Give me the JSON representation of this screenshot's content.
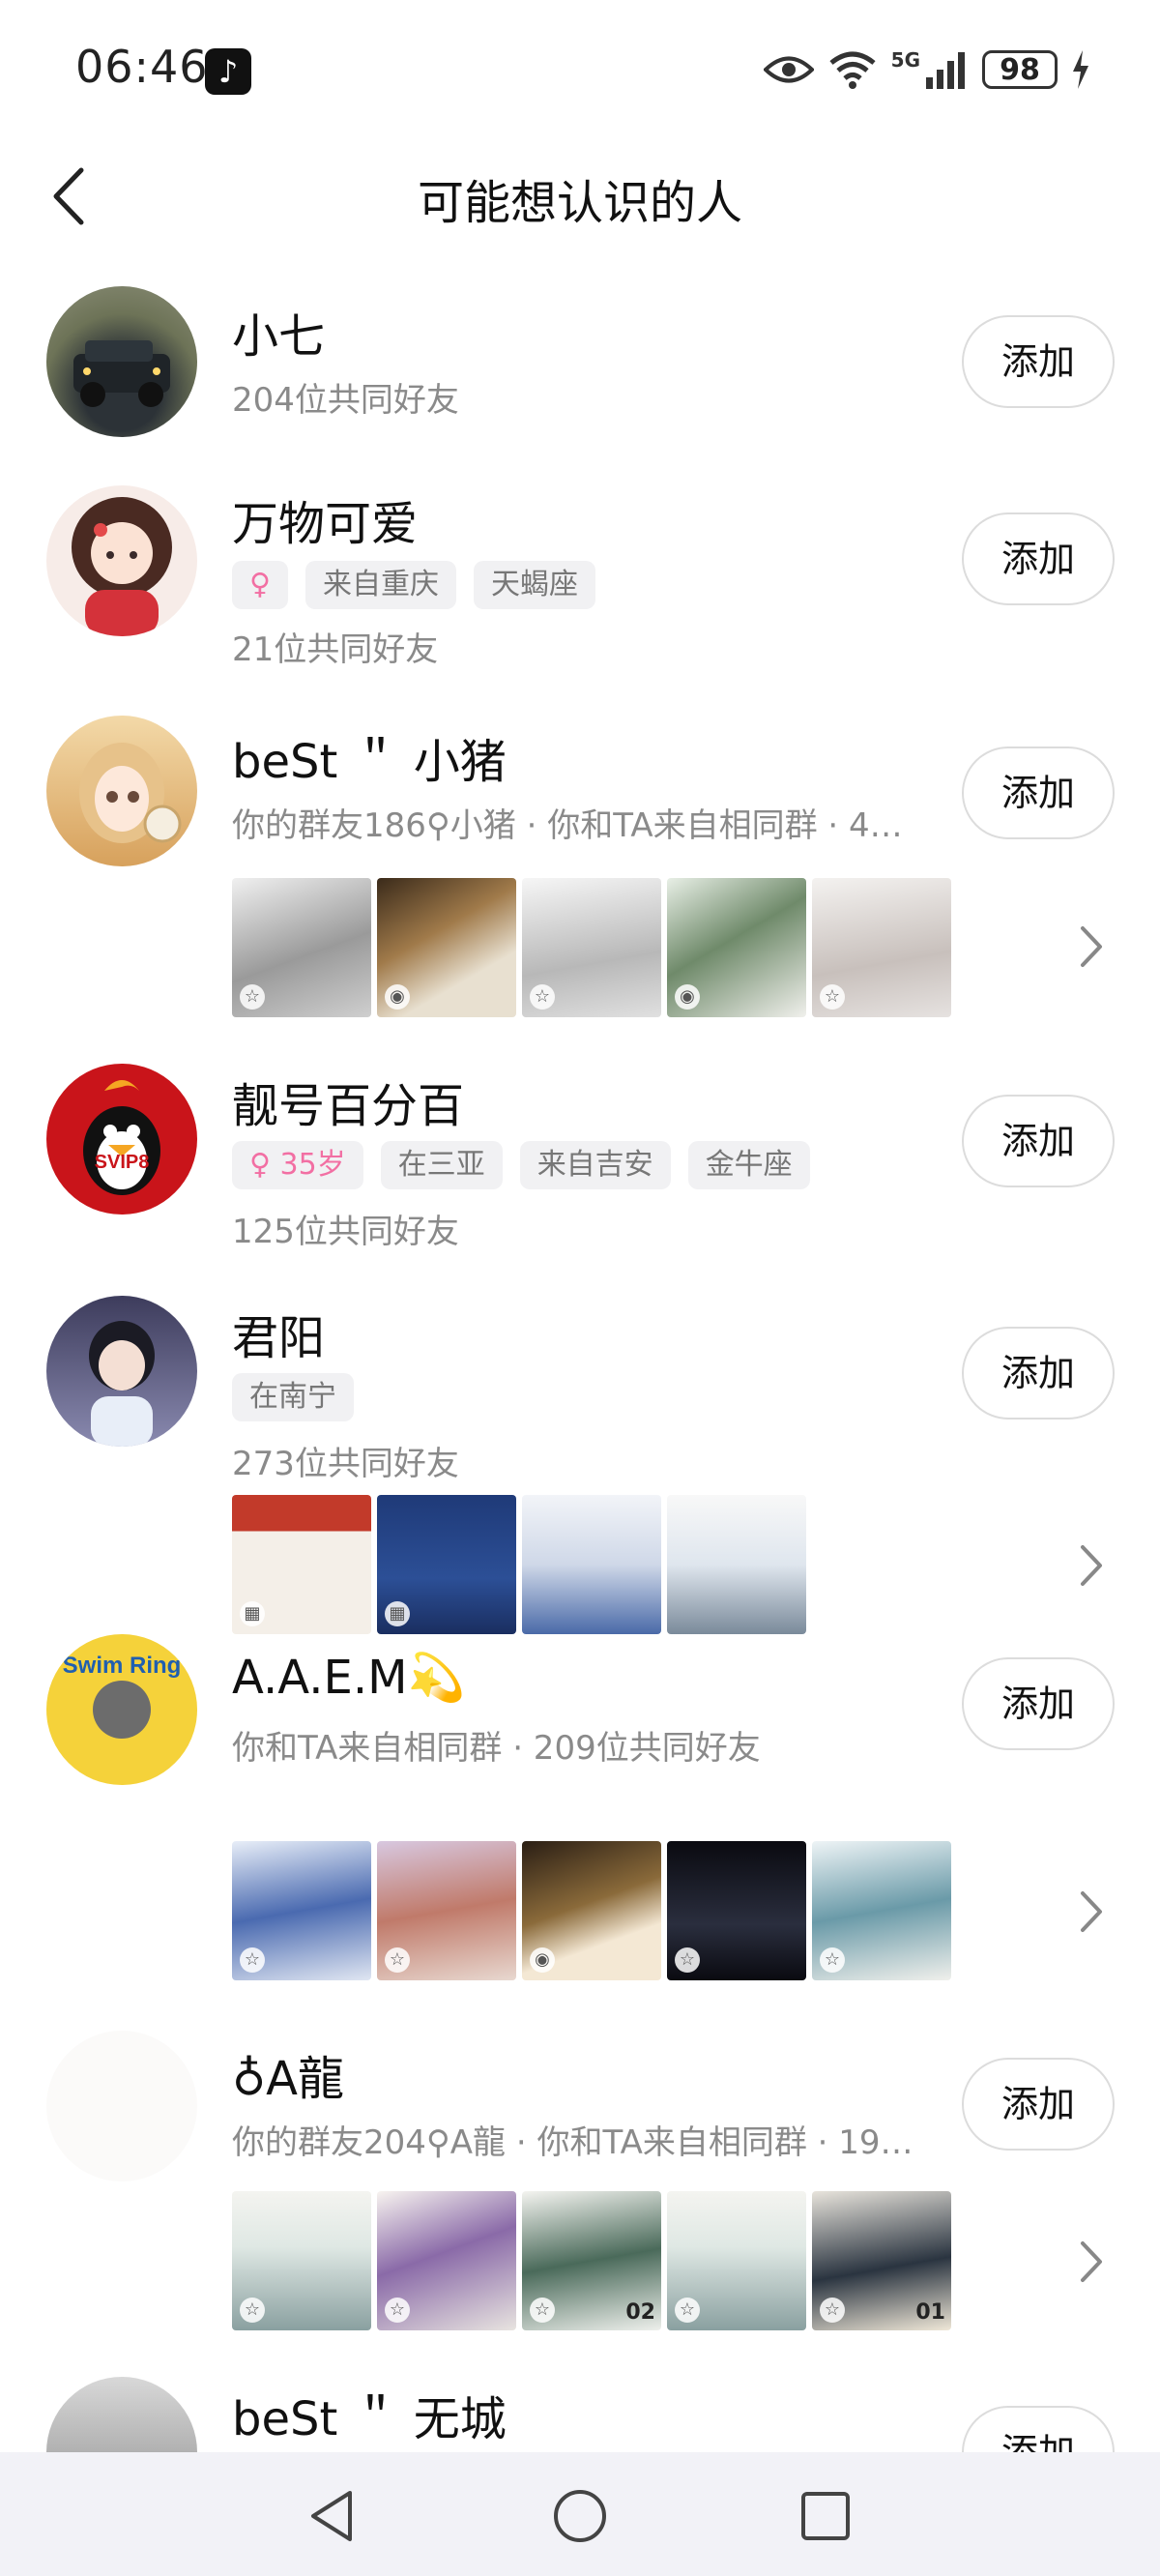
{
  "status": {
    "time": "06:46",
    "network": "5G",
    "battery": "98"
  },
  "header": {
    "title": "可能想认识的人"
  },
  "add_label": "添加",
  "people": [
    {
      "name": "小七",
      "tags": [],
      "subtext": "204位共同好友",
      "avatar_icon": "car-photo",
      "thumbs": []
    },
    {
      "name": "万物可爱",
      "tags": [
        {
          "label": "♀",
          "female": true
        },
        {
          "label": "来自重庆"
        },
        {
          "label": "天蝎座"
        }
      ],
      "subtext": "21位共同好友",
      "avatar_icon": "cartoon-girl"
    },
    {
      "name": "beSt ＂ 小猪",
      "tags": [],
      "subtext": "你的群友186⚲小猪 · 你和TA来自相同群 · 4…",
      "avatar_icon": "anime-girl"
    },
    {
      "name": "靓号百分百",
      "tags": [
        {
          "label": "♀ 35岁",
          "female": true
        },
        {
          "label": "在三亚"
        },
        {
          "label": "来自吉安"
        },
        {
          "label": "金牛座"
        }
      ],
      "subtext": "125位共同好友",
      "avatar_icon": "qq-penguin-svip8"
    },
    {
      "name": "君阳",
      "tags": [
        {
          "label": "在南宁"
        }
      ],
      "subtext": "273位共同好友",
      "avatar_icon": "anime-boy"
    },
    {
      "name": "A.A.E.M💫",
      "tags": [],
      "subtext": "你和TA来自相同群 · 209位共同好友",
      "avatar_icon": "swim-ring"
    },
    {
      "name": "♁A龍",
      "tags": [],
      "subtext": "你的群友204⚲A龍 · 你和TA来自相同群 · 19…",
      "avatar_icon": "blank-avatar"
    },
    {
      "name": "beSt ＂ 无城",
      "tags": [],
      "subtext": "",
      "avatar_icon": "man-photo"
    }
  ],
  "thumb_nums": {
    "row7_t3": "02",
    "row7_t5": "01"
  },
  "colors": {
    "accent_female": "#f26fa3",
    "text_secondary": "#8a8a8a",
    "navbar_bg": "#f2f2f7"
  }
}
